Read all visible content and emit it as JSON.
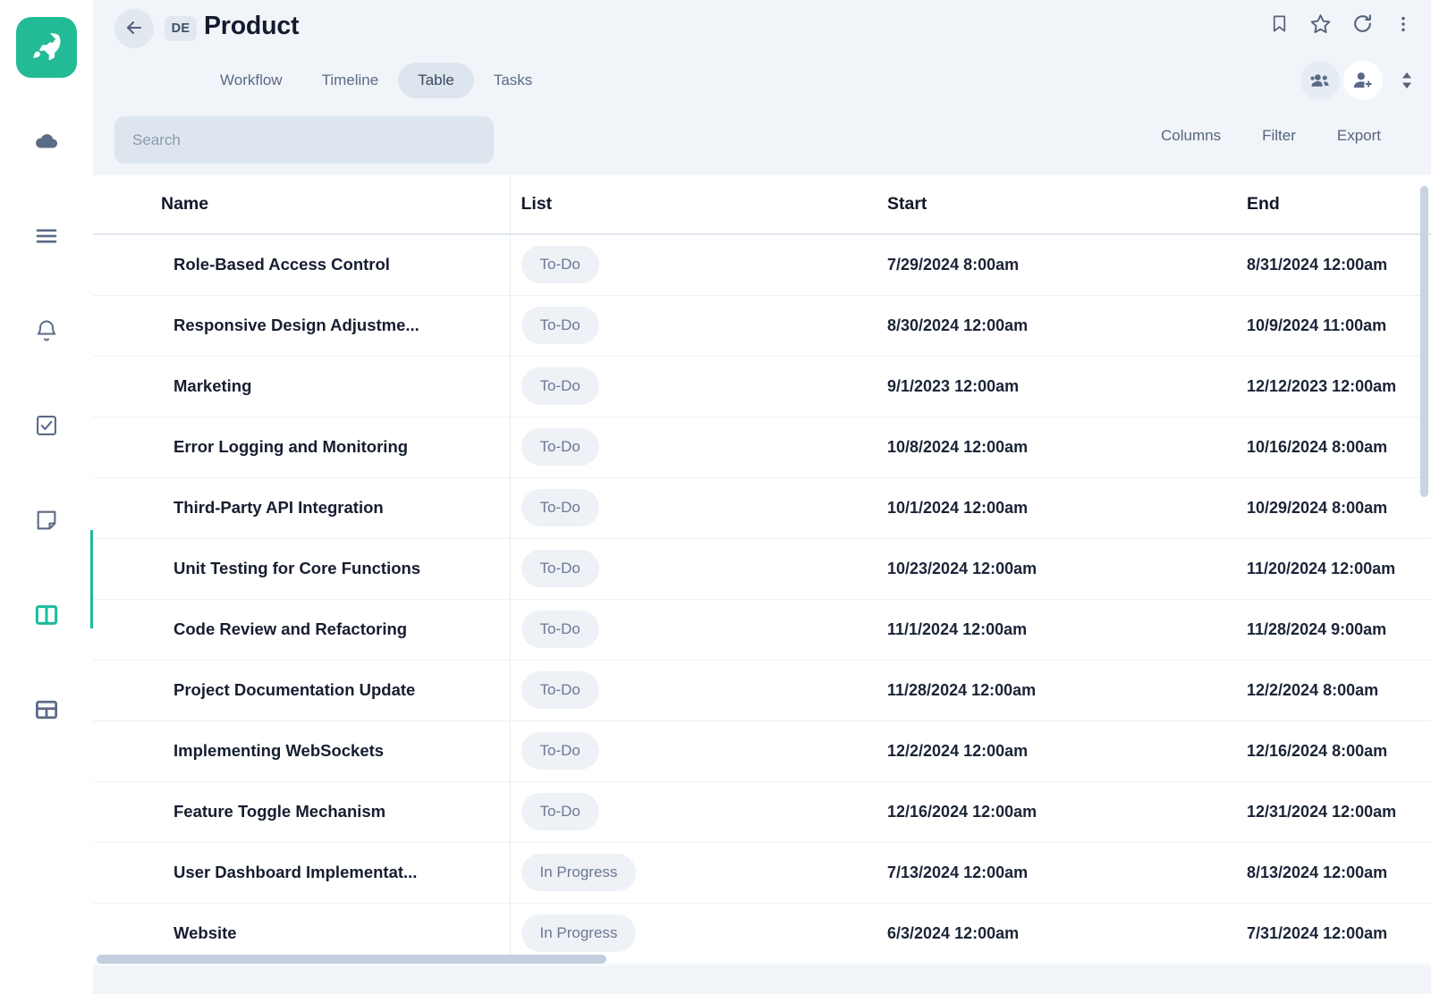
{
  "app": {
    "logo_icon": "rocket-icon",
    "accent_color": "#22bb96",
    "background_color": "#f1f5f9"
  },
  "sidebar": {
    "items": [
      {
        "icon": "rocket-icon",
        "name": "logo",
        "active": false
      },
      {
        "icon": "cloud-icon",
        "name": "cloud",
        "active": false
      },
      {
        "icon": "menu-icon",
        "name": "menu",
        "active": false
      },
      {
        "icon": "bell-icon",
        "name": "notifications",
        "active": false
      },
      {
        "icon": "checkbox-icon",
        "name": "tasks",
        "active": false
      },
      {
        "icon": "note-icon",
        "name": "notes",
        "active": false
      },
      {
        "icon": "board-icon",
        "name": "board",
        "active": true
      },
      {
        "icon": "grid-icon",
        "name": "grid",
        "active": false
      }
    ]
  },
  "header": {
    "back_icon": "arrow-left-icon",
    "avatar_initials": "DE",
    "title": "Product",
    "tabs": [
      {
        "label": "Workflow",
        "active": false
      },
      {
        "label": "Timeline",
        "active": false
      },
      {
        "label": "Table",
        "active": true
      },
      {
        "label": "Tasks",
        "active": false
      }
    ],
    "icons_top": [
      {
        "name": "bookmark-icon"
      },
      {
        "name": "star-icon"
      },
      {
        "name": "refresh-icon"
      },
      {
        "name": "more-vertical-icon"
      }
    ],
    "icons_bottom": [
      {
        "name": "people-group-icon"
      },
      {
        "name": "person-add-icon"
      },
      {
        "name": "sort-updown-icon"
      }
    ]
  },
  "toolbar": {
    "search_placeholder": "Search",
    "search_value": "",
    "columns_label": "Columns",
    "filter_label": "Filter",
    "export_label": "Export"
  },
  "table": {
    "columns": [
      "Name",
      "List",
      "Start",
      "End"
    ],
    "rows": [
      {
        "name": "Role-Based Access Control",
        "list": "To-Do",
        "start": "7/29/2024 8:00am",
        "end": "8/31/2024 12:00am"
      },
      {
        "name": "Responsive Design Adjustme...",
        "list": "To-Do",
        "start": "8/30/2024 12:00am",
        "end": "10/9/2024 11:00am"
      },
      {
        "name": "Marketing",
        "list": "To-Do",
        "start": "9/1/2023 12:00am",
        "end": "12/12/2023 12:00am"
      },
      {
        "name": "Error Logging and Monitoring",
        "list": "To-Do",
        "start": "10/8/2024 12:00am",
        "end": "10/16/2024 8:00am"
      },
      {
        "name": "Third-Party API Integration",
        "list": "To-Do",
        "start": "10/1/2024 12:00am",
        "end": "10/29/2024 8:00am"
      },
      {
        "name": "Unit Testing for Core Functions",
        "list": "To-Do",
        "start": "10/23/2024 12:00am",
        "end": "11/20/2024 12:00am"
      },
      {
        "name": "Code Review and Refactoring",
        "list": "To-Do",
        "start": "11/1/2024 12:00am",
        "end": "11/28/2024 9:00am"
      },
      {
        "name": "Project Documentation Update",
        "list": "To-Do",
        "start": "11/28/2024 12:00am",
        "end": "12/2/2024 8:00am"
      },
      {
        "name": "Implementing WebSockets",
        "list": "To-Do",
        "start": "12/2/2024 12:00am",
        "end": "12/16/2024 8:00am"
      },
      {
        "name": "Feature Toggle Mechanism",
        "list": "To-Do",
        "start": "12/16/2024 12:00am",
        "end": "12/31/2024 12:00am"
      },
      {
        "name": "User Dashboard Implementat...",
        "list": "In Progress",
        "start": "7/13/2024 12:00am",
        "end": "8/13/2024 12:00am"
      },
      {
        "name": "Website",
        "list": "In Progress",
        "start": "6/3/2024 12:00am",
        "end": "7/31/2024 12:00am"
      }
    ]
  }
}
